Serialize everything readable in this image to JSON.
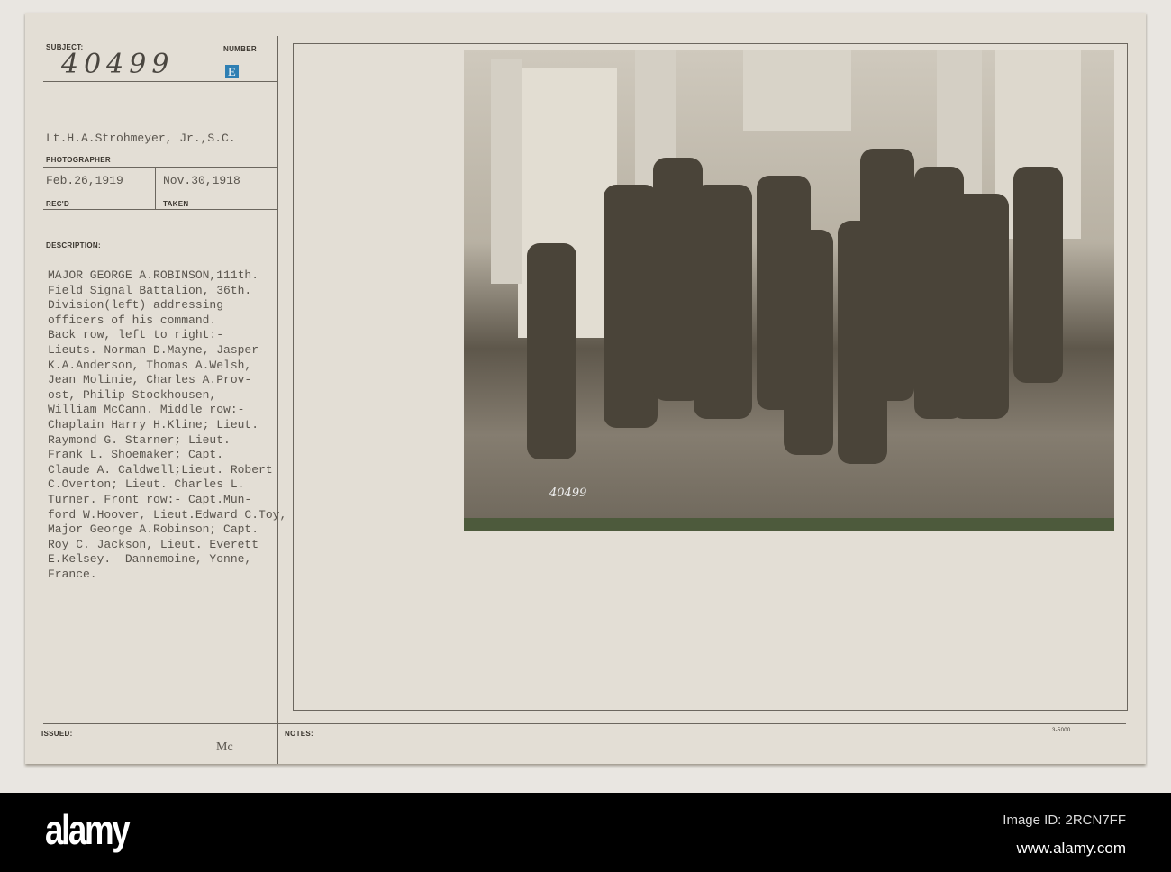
{
  "card": {
    "subject_label": "SUBJECT:",
    "subject_value": "40499",
    "number_label": "NUMBER",
    "number_value": "E",
    "photographer": "Lt.H.A.Strohmeyer, Jr.,S.C.",
    "photographer_label": "PHOTOGRAPHER",
    "received": "Feb.26,1919",
    "received_label": "REC'D",
    "taken": "Nov.30,1918",
    "taken_label": "TAKEN",
    "description_label": "DESCRIPTION:",
    "description_lines": [
      "MAJOR GEORGE A.ROBINSON,111th.",
      "Field Signal Battalion, 36th.",
      "Division(left) addressing",
      "officers of his command.",
      "Back row, left to right:-",
      "Lieuts. Norman D.Mayne, Jasper",
      "K.A.Anderson, Thomas A.Welsh,",
      "Jean Molinie, Charles A.Prov-",
      "ost, Philip Stockhousen,",
      "William McCann. Middle row:-",
      "Chaplain Harry H.Kline; Lieut.",
      "Raymond G. Starner; Lieut.",
      "Frank L. Shoemaker; Capt.",
      "Claude A. Caldwell;Lieut. Robert",
      "C.Overton; Lieut. Charles L.",
      "Turner. Front row:- Capt.Mun-",
      "ford W.Hoover, Lieut.Edward C.Toy,",
      "Major George A.Robinson; Capt.",
      "Roy C. Jackson, Lieut. Everett",
      "E.Kelsey.  Dannemoine, Yonne,",
      "France."
    ],
    "photo_number": "40499",
    "issued_label": "ISSUED:",
    "issued_value": "Mc",
    "notes_label": "NOTES:",
    "form_number": "3-5000"
  },
  "footer": {
    "logo": "alamy",
    "image_id": "Image ID: 2RCN7FF",
    "url": "www.alamy.com"
  }
}
